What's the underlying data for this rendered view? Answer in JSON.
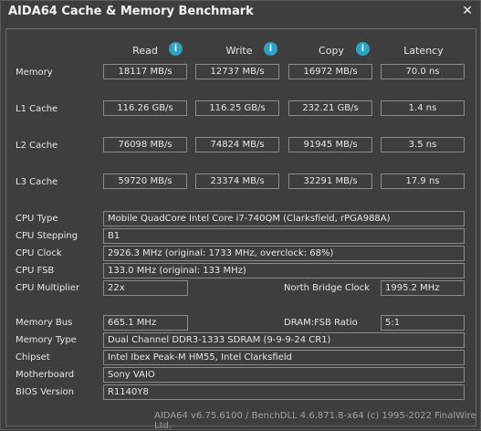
{
  "window": {
    "title": "AIDA64 Cache & Memory Benchmark",
    "close_glyph": "✕"
  },
  "columns": {
    "read": "Read",
    "write": "Write",
    "copy": "Copy",
    "latency": "Latency",
    "info_glyph": "i"
  },
  "bench": {
    "memory": {
      "label": "Memory",
      "read": "18117 MB/s",
      "write": "12737 MB/s",
      "copy": "16972 MB/s",
      "latency": "70.0 ns"
    },
    "l1": {
      "label": "L1 Cache",
      "read": "116.26 GB/s",
      "write": "116.25 GB/s",
      "copy": "232.21 GB/s",
      "latency": "1.4 ns"
    },
    "l2": {
      "label": "L2 Cache",
      "read": "76098 MB/s",
      "write": "74824 MB/s",
      "copy": "91945 MB/s",
      "latency": "3.5 ns"
    },
    "l3": {
      "label": "L3 Cache",
      "read": "59720 MB/s",
      "write": "23374 MB/s",
      "copy": "32291 MB/s",
      "latency": "17.9 ns"
    }
  },
  "info": {
    "cpu_type": {
      "label": "CPU Type",
      "value": "Mobile QuadCore Intel Core i7-740QM  (Clarksfield, rPGA988A)"
    },
    "cpu_stepping": {
      "label": "CPU Stepping",
      "value": "B1"
    },
    "cpu_clock": {
      "label": "CPU Clock",
      "value": "2926.3 MHz  (original: 1733 MHz, overclock: 68%)"
    },
    "cpu_fsb": {
      "label": "CPU FSB",
      "value": "133.0 MHz  (original: 133 MHz)"
    },
    "cpu_multiplier": {
      "label": "CPU Multiplier",
      "value": "22x"
    },
    "north_bridge_clock": {
      "label": "North Bridge Clock",
      "value": "1995.2 MHz"
    },
    "memory_bus": {
      "label": "Memory Bus",
      "value": "665.1 MHz"
    },
    "dram_fsb_ratio": {
      "label": "DRAM:FSB Ratio",
      "value": "5:1"
    },
    "memory_type": {
      "label": "Memory Type",
      "value": "Dual Channel DDR3-1333 SDRAM  (9-9-9-24 CR1)"
    },
    "chipset": {
      "label": "Chipset",
      "value": "Intel Ibex Peak-M HM55, Intel Clarksfield"
    },
    "motherboard": {
      "label": "Motherboard",
      "value": "Sony VAIO"
    },
    "bios_version": {
      "label": "BIOS Version",
      "value": "R1140Y8"
    }
  },
  "footer": "AIDA64 v6.75.6100 / BenchDLL 4.6.871.8-x64  (c) 1995-2022 FinalWire Ltd."
}
